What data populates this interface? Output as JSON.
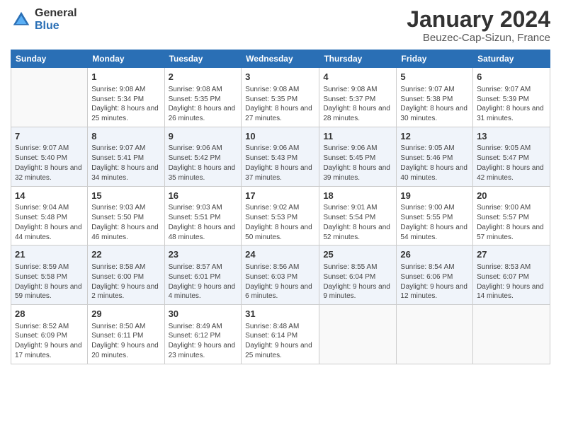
{
  "header": {
    "logo_line1": "General",
    "logo_line2": "Blue",
    "month": "January 2024",
    "location": "Beuzec-Cap-Sizun, France"
  },
  "days_of_week": [
    "Sunday",
    "Monday",
    "Tuesday",
    "Wednesday",
    "Thursday",
    "Friday",
    "Saturday"
  ],
  "weeks": [
    [
      {
        "num": "",
        "sunrise": "",
        "sunset": "",
        "daylight": ""
      },
      {
        "num": "1",
        "sunrise": "Sunrise: 9:08 AM",
        "sunset": "Sunset: 5:34 PM",
        "daylight": "Daylight: 8 hours and 25 minutes."
      },
      {
        "num": "2",
        "sunrise": "Sunrise: 9:08 AM",
        "sunset": "Sunset: 5:35 PM",
        "daylight": "Daylight: 8 hours and 26 minutes."
      },
      {
        "num": "3",
        "sunrise": "Sunrise: 9:08 AM",
        "sunset": "Sunset: 5:35 PM",
        "daylight": "Daylight: 8 hours and 27 minutes."
      },
      {
        "num": "4",
        "sunrise": "Sunrise: 9:08 AM",
        "sunset": "Sunset: 5:37 PM",
        "daylight": "Daylight: 8 hours and 28 minutes."
      },
      {
        "num": "5",
        "sunrise": "Sunrise: 9:07 AM",
        "sunset": "Sunset: 5:38 PM",
        "daylight": "Daylight: 8 hours and 30 minutes."
      },
      {
        "num": "6",
        "sunrise": "Sunrise: 9:07 AM",
        "sunset": "Sunset: 5:39 PM",
        "daylight": "Daylight: 8 hours and 31 minutes."
      }
    ],
    [
      {
        "num": "7",
        "sunrise": "Sunrise: 9:07 AM",
        "sunset": "Sunset: 5:40 PM",
        "daylight": "Daylight: 8 hours and 32 minutes."
      },
      {
        "num": "8",
        "sunrise": "Sunrise: 9:07 AM",
        "sunset": "Sunset: 5:41 PM",
        "daylight": "Daylight: 8 hours and 34 minutes."
      },
      {
        "num": "9",
        "sunrise": "Sunrise: 9:06 AM",
        "sunset": "Sunset: 5:42 PM",
        "daylight": "Daylight: 8 hours and 35 minutes."
      },
      {
        "num": "10",
        "sunrise": "Sunrise: 9:06 AM",
        "sunset": "Sunset: 5:43 PM",
        "daylight": "Daylight: 8 hours and 37 minutes."
      },
      {
        "num": "11",
        "sunrise": "Sunrise: 9:06 AM",
        "sunset": "Sunset: 5:45 PM",
        "daylight": "Daylight: 8 hours and 39 minutes."
      },
      {
        "num": "12",
        "sunrise": "Sunrise: 9:05 AM",
        "sunset": "Sunset: 5:46 PM",
        "daylight": "Daylight: 8 hours and 40 minutes."
      },
      {
        "num": "13",
        "sunrise": "Sunrise: 9:05 AM",
        "sunset": "Sunset: 5:47 PM",
        "daylight": "Daylight: 8 hours and 42 minutes."
      }
    ],
    [
      {
        "num": "14",
        "sunrise": "Sunrise: 9:04 AM",
        "sunset": "Sunset: 5:48 PM",
        "daylight": "Daylight: 8 hours and 44 minutes."
      },
      {
        "num": "15",
        "sunrise": "Sunrise: 9:03 AM",
        "sunset": "Sunset: 5:50 PM",
        "daylight": "Daylight: 8 hours and 46 minutes."
      },
      {
        "num": "16",
        "sunrise": "Sunrise: 9:03 AM",
        "sunset": "Sunset: 5:51 PM",
        "daylight": "Daylight: 8 hours and 48 minutes."
      },
      {
        "num": "17",
        "sunrise": "Sunrise: 9:02 AM",
        "sunset": "Sunset: 5:53 PM",
        "daylight": "Daylight: 8 hours and 50 minutes."
      },
      {
        "num": "18",
        "sunrise": "Sunrise: 9:01 AM",
        "sunset": "Sunset: 5:54 PM",
        "daylight": "Daylight: 8 hours and 52 minutes."
      },
      {
        "num": "19",
        "sunrise": "Sunrise: 9:00 AM",
        "sunset": "Sunset: 5:55 PM",
        "daylight": "Daylight: 8 hours and 54 minutes."
      },
      {
        "num": "20",
        "sunrise": "Sunrise: 9:00 AM",
        "sunset": "Sunset: 5:57 PM",
        "daylight": "Daylight: 8 hours and 57 minutes."
      }
    ],
    [
      {
        "num": "21",
        "sunrise": "Sunrise: 8:59 AM",
        "sunset": "Sunset: 5:58 PM",
        "daylight": "Daylight: 8 hours and 59 minutes."
      },
      {
        "num": "22",
        "sunrise": "Sunrise: 8:58 AM",
        "sunset": "Sunset: 6:00 PM",
        "daylight": "Daylight: 9 hours and 2 minutes."
      },
      {
        "num": "23",
        "sunrise": "Sunrise: 8:57 AM",
        "sunset": "Sunset: 6:01 PM",
        "daylight": "Daylight: 9 hours and 4 minutes."
      },
      {
        "num": "24",
        "sunrise": "Sunrise: 8:56 AM",
        "sunset": "Sunset: 6:03 PM",
        "daylight": "Daylight: 9 hours and 6 minutes."
      },
      {
        "num": "25",
        "sunrise": "Sunrise: 8:55 AM",
        "sunset": "Sunset: 6:04 PM",
        "daylight": "Daylight: 9 hours and 9 minutes."
      },
      {
        "num": "26",
        "sunrise": "Sunrise: 8:54 AM",
        "sunset": "Sunset: 6:06 PM",
        "daylight": "Daylight: 9 hours and 12 minutes."
      },
      {
        "num": "27",
        "sunrise": "Sunrise: 8:53 AM",
        "sunset": "Sunset: 6:07 PM",
        "daylight": "Daylight: 9 hours and 14 minutes."
      }
    ],
    [
      {
        "num": "28",
        "sunrise": "Sunrise: 8:52 AM",
        "sunset": "Sunset: 6:09 PM",
        "daylight": "Daylight: 9 hours and 17 minutes."
      },
      {
        "num": "29",
        "sunrise": "Sunrise: 8:50 AM",
        "sunset": "Sunset: 6:11 PM",
        "daylight": "Daylight: 9 hours and 20 minutes."
      },
      {
        "num": "30",
        "sunrise": "Sunrise: 8:49 AM",
        "sunset": "Sunset: 6:12 PM",
        "daylight": "Daylight: 9 hours and 23 minutes."
      },
      {
        "num": "31",
        "sunrise": "Sunrise: 8:48 AM",
        "sunset": "Sunset: 6:14 PM",
        "daylight": "Daylight: 9 hours and 25 minutes."
      },
      {
        "num": "",
        "sunrise": "",
        "sunset": "",
        "daylight": ""
      },
      {
        "num": "",
        "sunrise": "",
        "sunset": "",
        "daylight": ""
      },
      {
        "num": "",
        "sunrise": "",
        "sunset": "",
        "daylight": ""
      }
    ]
  ]
}
